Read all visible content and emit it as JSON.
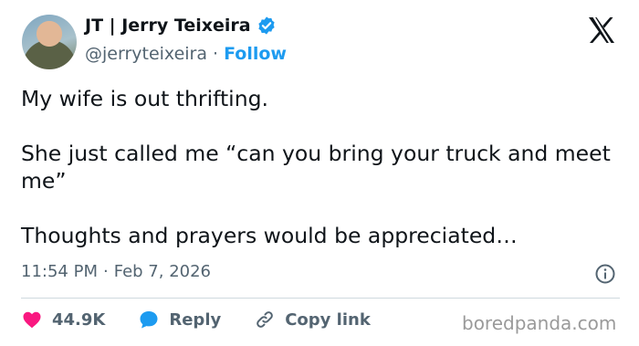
{
  "author": {
    "name": "JT | Jerry Teixeira",
    "handle": "@jerryteixeira",
    "follow_label": "Follow",
    "separator": "·"
  },
  "tweet": {
    "text": "My wife is out thrifting.\n\nShe just called me “can you bring your truck and meet me”\n\nThoughts and prayers would be appreciated…",
    "time": "11:54 PM",
    "date": "Feb 7, 2026"
  },
  "actions": {
    "likes": "44.9K",
    "reply_label": "Reply",
    "copy_label": "Copy link"
  },
  "watermark": "boredpanda.com",
  "colors": {
    "accent": "#1d9bf0",
    "like": "#f91880",
    "text": "#0f1419",
    "muted": "#536471"
  },
  "icons": [
    "verified-badge-icon",
    "x-logo-icon",
    "info-icon",
    "heart-icon",
    "reply-bubble-icon",
    "link-icon"
  ]
}
